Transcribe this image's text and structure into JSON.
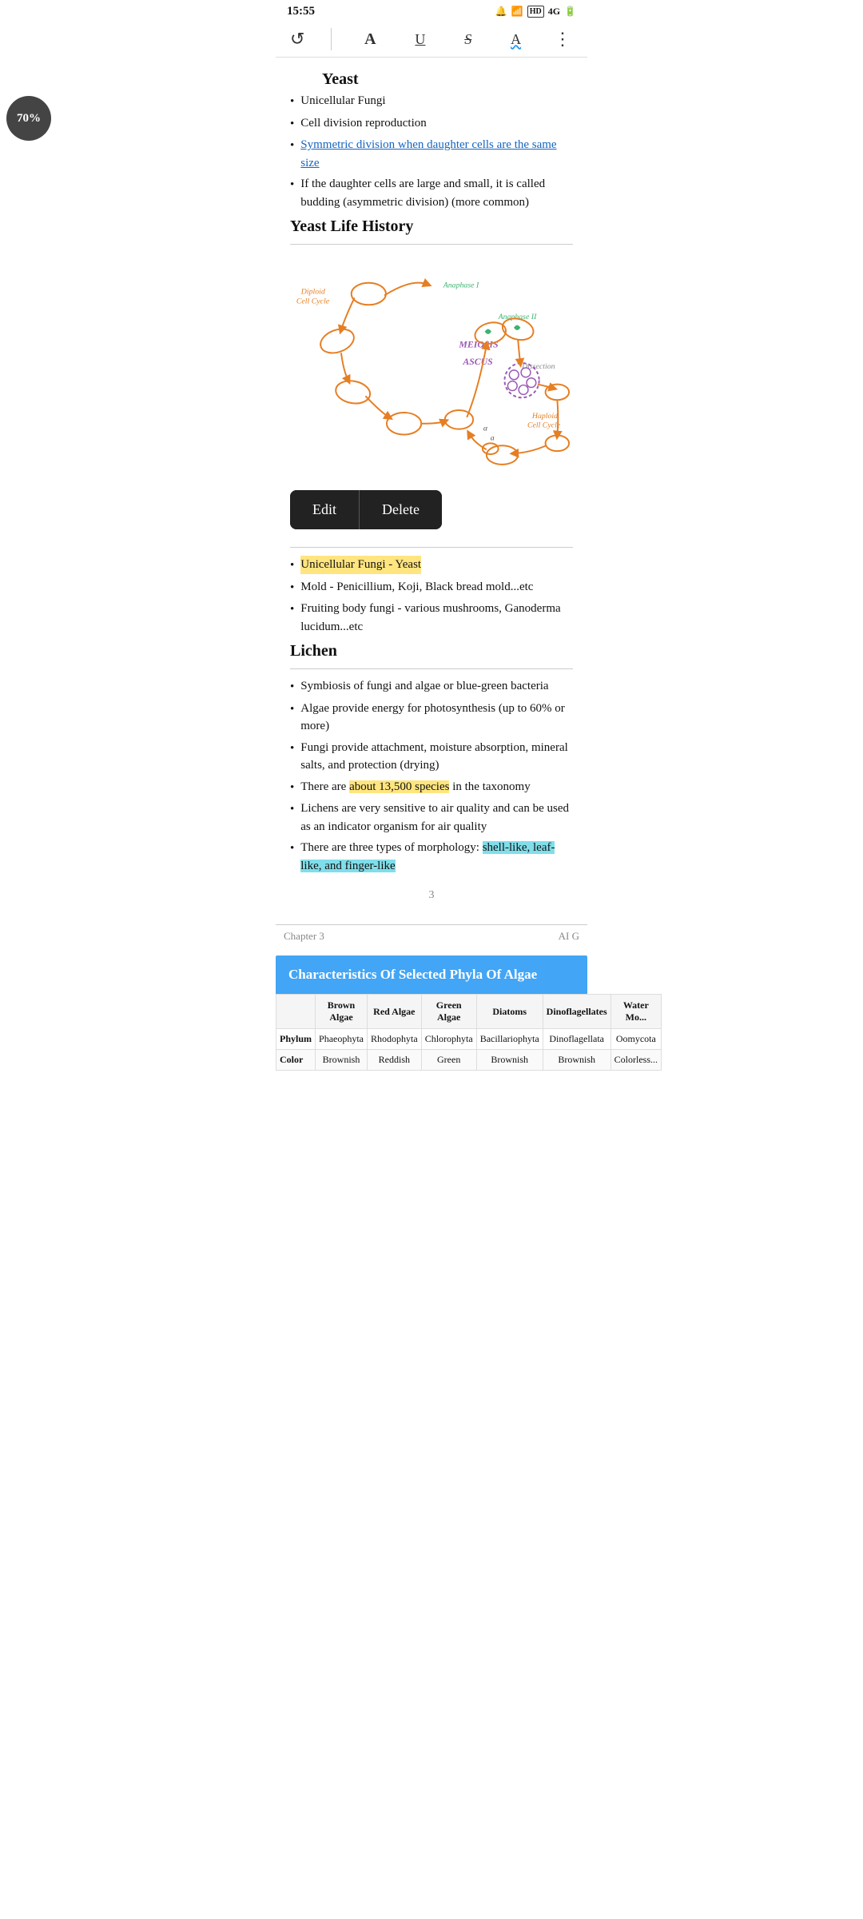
{
  "statusBar": {
    "time": "15:55",
    "icons": "🔇 📶 HD 4G 🔋"
  },
  "toolbar": {
    "undoLabel": "↺",
    "boldLabel": "A",
    "underlineLabel": "U",
    "strikeLabel": "S",
    "waveLabel": "A",
    "moreLabel": "⋮"
  },
  "zoom": {
    "percent": "70%"
  },
  "yeast": {
    "title": "Yeast",
    "bullets": [
      "Unicellular Fungi",
      "Cell division reproduction",
      "Symmetric division when daughter cells are the same size",
      "If the daughter cells are large and small, it is called budding (asymmetric division) (more common)"
    ],
    "lifeHistoryTitle": "Yeast Life History",
    "diagramLabels": {
      "diploid": "Diploid\nCell Cycle",
      "anaphase1": "Anaphase I",
      "anaphase2": "Anaphase II",
      "meiosis": "MEIOSIS",
      "ascus": "ASCUS",
      "dissection": "Dissection",
      "haploid": "Haploid\nCell Cycle"
    }
  },
  "editDeleteBar": {
    "editLabel": "Edit",
    "deleteLabel": "Delete"
  },
  "fungiList": {
    "bullets": [
      "Unicellular Fungi - Yeast",
      "Mold - Penicillium, Koji, Black bread mold...etc",
      "Fruiting body fungi - various mushrooms, Ganoderma lucidum...etc"
    ],
    "unicellularHighlight": "Unicellular Fungi - Yeast"
  },
  "lichen": {
    "title": "Lichen",
    "bullets": [
      "Symbiosis of fungi and algae or blue-green bacteria",
      "Algae provide energy for photosynthesis (up to 60% or more)",
      "Fungi provide attachment, moisture absorption, mineral salts, and protection (drying)",
      "There are about 13,500 species in the taxonomy",
      "Lichens are very sensitive to air quality and can be used as an indicator organism for air quality",
      "There are three types of morphology: shell-like, leaf-like, and finger-like"
    ],
    "highlight13500": "about 13,500 species",
    "highlightMorphology": "shell-like, leaf-like, and finger-like"
  },
  "pageNumber": "3",
  "chapterFooter": {
    "left": "Chapter 3",
    "right": "AI G"
  },
  "algaeTable": {
    "headerTitle": "Characteristics Of Selected Phyla Of Algae",
    "columns": [
      "",
      "Brown Algae",
      "Red Algae",
      "Green Algae",
      "Diatoms",
      "Dinoflagellates",
      "Water Mo..."
    ],
    "rows": [
      {
        "label": "Phylum",
        "values": [
          "Phaeophyta",
          "Rhodophyta",
          "Chlorophyta",
          "Bacillariophyta",
          "Dinoflagellata",
          "Oomycota"
        ]
      },
      {
        "label": "Color",
        "values": [
          "Brownish",
          "Reddish",
          "Green",
          "Brownish",
          "Brownish",
          "Colorless..."
        ]
      }
    ]
  }
}
